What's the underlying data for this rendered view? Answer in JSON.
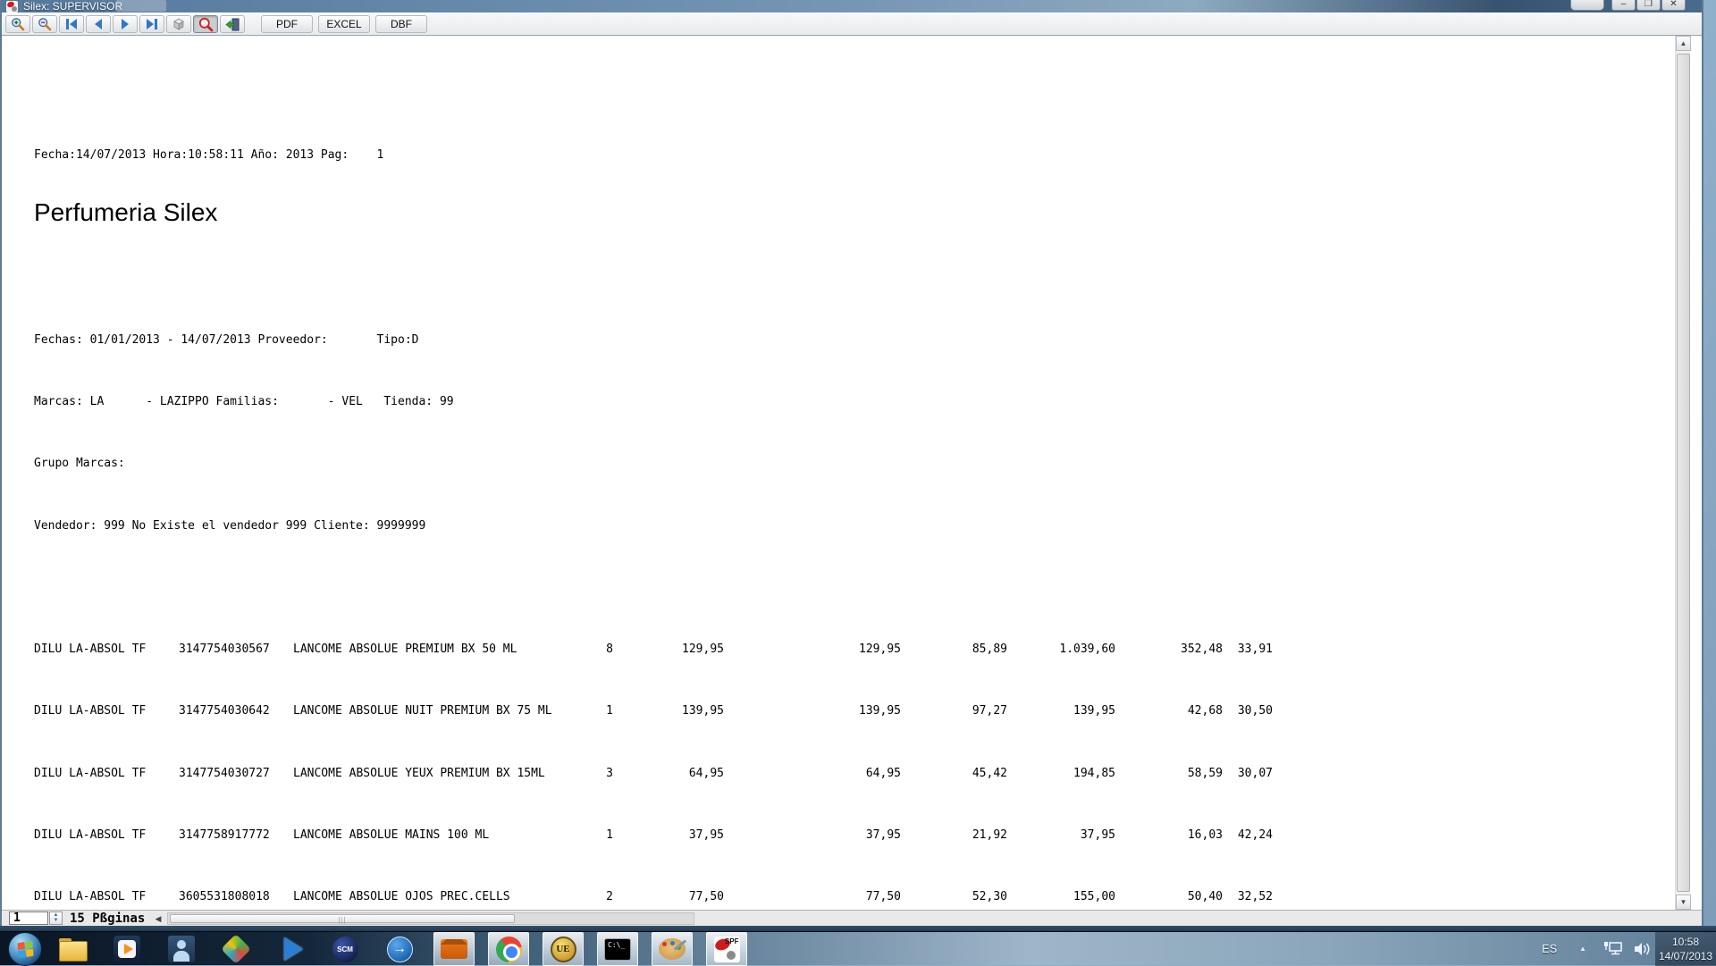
{
  "window": {
    "title": "Silex: SUPERVISOR",
    "min_label": "–",
    "max_label": "❐",
    "close_label": "✕"
  },
  "toolbar": {
    "export": [
      "PDF",
      "EXCEL",
      "DBF"
    ]
  },
  "report": {
    "meta_line": "Fecha:14/07/2013 Hora:10:58:11 Año: 2013 Pag:    1",
    "title": "Perfumeria Silex",
    "filter_lines": [
      "Fechas: 01/01/2013 - 14/07/2013 Proveedor:       Tipo:D",
      "Marcas: LA      - LAZIPPO Familias:       - VEL   Tienda: 99",
      "Grupo Marcas:",
      "Vendedor: 999 No Existe el vendedor 999 Cliente: 9999999"
    ],
    "rows": [
      {
        "brand": "DILU LA-ABSOL TF",
        "code": "3147754030567",
        "desc": "LANCOME ABSOLUE PREMIUM BX 50 ML",
        "qty": "8",
        "pvp": "129,95",
        "pvp2": "129,95",
        "cost": "85,89",
        "total": "1.039,60",
        "margin": "352,48",
        "pct": "33,91"
      },
      {
        "brand": "DILU LA-ABSOL TF",
        "code": "3147754030642",
        "desc": "LANCOME ABSOLUE NUIT PREMIUM BX 75 ML",
        "qty": "1",
        "pvp": "139,95",
        "pvp2": "139,95",
        "cost": "97,27",
        "total": "139,95",
        "margin": "42,68",
        "pct": "30,50"
      },
      {
        "brand": "DILU LA-ABSOL TF",
        "code": "3147754030727",
        "desc": "LANCOME ABSOLUE YEUX PREMIUM BX 15ML",
        "qty": "3",
        "pvp": "64,95",
        "pvp2": "64,95",
        "cost": "45,42",
        "total": "194,85",
        "margin": "58,59",
        "pct": "30,07"
      },
      {
        "brand": "DILU LA-ABSOL TF",
        "code": "3147758917772",
        "desc": "LANCOME ABSOLUE MAINS 100 ML",
        "qty": "1",
        "pvp": "37,95",
        "pvp2": "37,95",
        "cost": "21,92",
        "total": "37,95",
        "margin": "16,03",
        "pct": "42,24"
      },
      {
        "brand": "DILU LA-ABSOL TF",
        "code": "3605531808018",
        "desc": "LANCOME ABSOLUE OJOS PREC.CELLS",
        "qty": "2",
        "pvp": "77,50",
        "pvp2": "77,50",
        "cost": "52,30",
        "total": "155,00",
        "margin": "50,40",
        "pct": "32,52"
      }
    ]
  },
  "statusbar": {
    "page": "1",
    "pages_label": "15 Pßginas"
  },
  "taskbar": {
    "scm_label": "SCM",
    "arrow_label": "→",
    "ue_label": "UE",
    "cmd_label": "C:\\_",
    "spf_label": "SPF",
    "tray": {
      "language": "ES",
      "time": "10:58",
      "date": "14/07/2013"
    }
  },
  "colors": {
    "accent_blue": "#2f77c8",
    "search_red": "#cc2222",
    "taskbar_dark": "#0b1624",
    "folder_yellow": "#e8b53c"
  }
}
